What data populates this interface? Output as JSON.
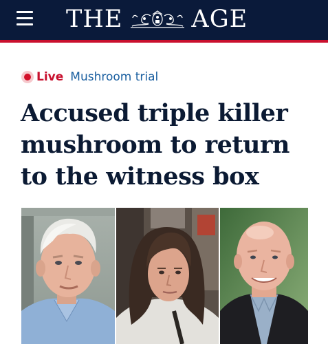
{
  "header": {
    "masthead_left": "THE",
    "masthead_right": "AGE",
    "crest_icon": "coat-of-arms-icon",
    "menu_icon": "hamburger-menu-icon",
    "bg_color": "#0a1a3a",
    "accent_color": "#c9102e"
  },
  "article": {
    "live_label": "Live",
    "topic": "Mushroom trial",
    "headline": "Accused triple killer mushroom to return to the witness box"
  },
  "photos": [
    {
      "name": "photo-older-man"
    },
    {
      "name": "photo-woman"
    },
    {
      "name": "photo-bald-man"
    }
  ]
}
